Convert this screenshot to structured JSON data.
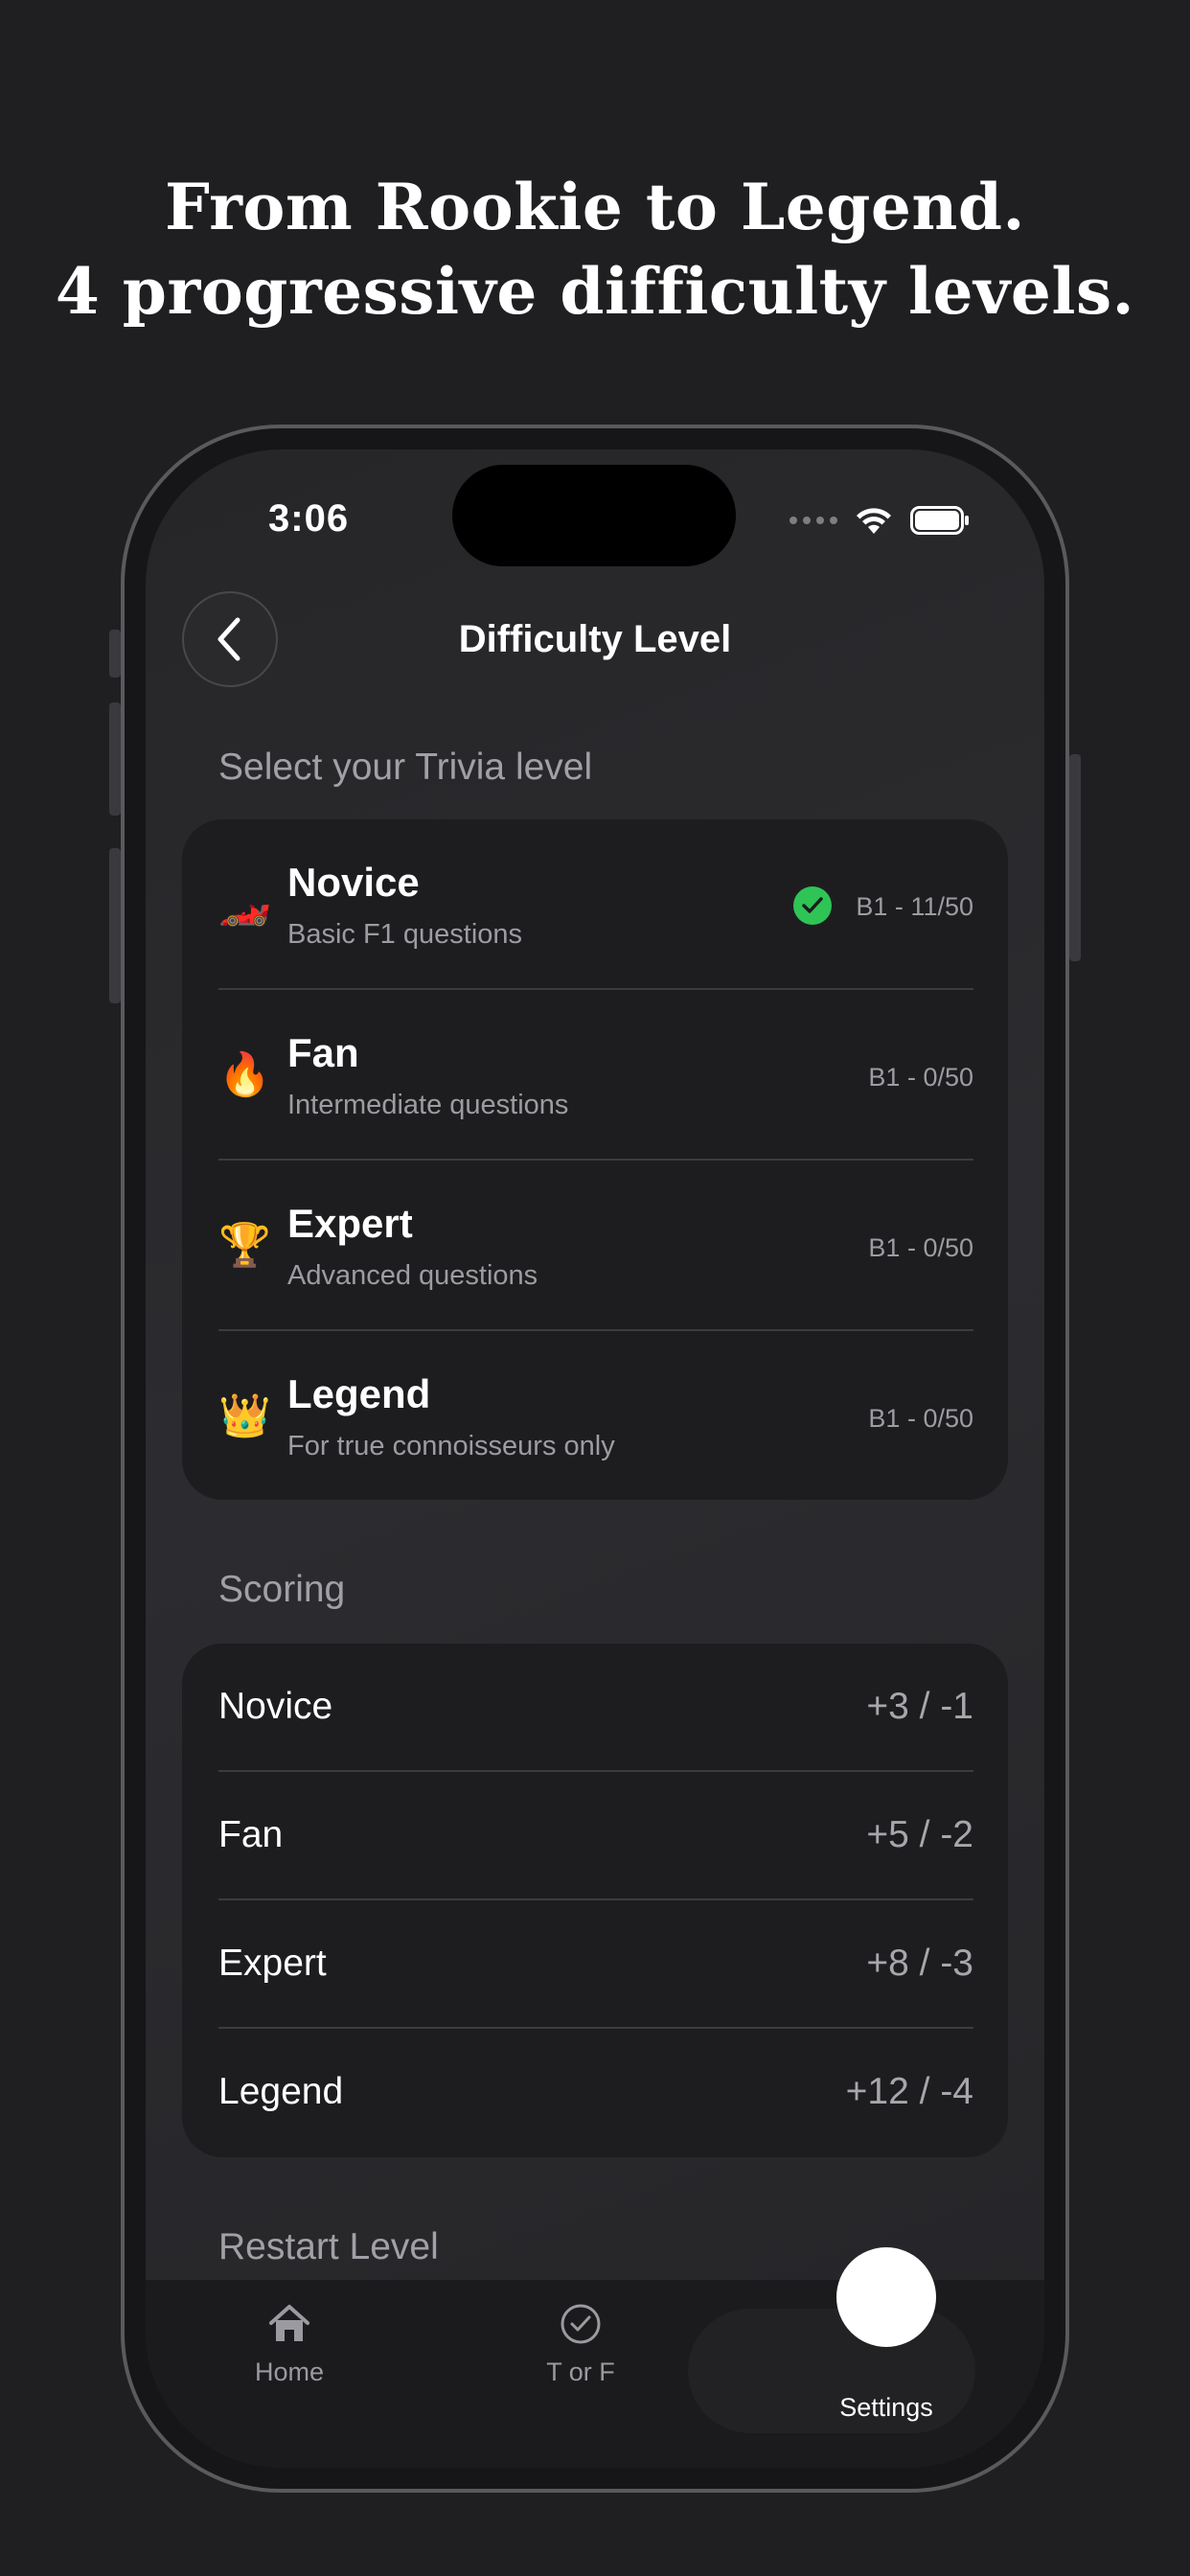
{
  "headline": {
    "line1": "From Rookie to Legend.",
    "line2": "4 progressive difficulty levels."
  },
  "status_bar": {
    "time": "3:06"
  },
  "nav": {
    "title": "Difficulty Level"
  },
  "levels_section": {
    "label": "Select your Trivia level",
    "items": [
      {
        "emoji": "🏎️",
        "icon": "race-car-icon",
        "name": "Novice",
        "description": "Basic F1 questions",
        "progress": "B1 - 11/50",
        "selected": true
      },
      {
        "emoji": "🔥",
        "icon": "fire-icon",
        "name": "Fan",
        "description": "Intermediate questions",
        "progress": "B1 - 0/50",
        "selected": false
      },
      {
        "emoji": "🏆",
        "icon": "trophy-icon",
        "name": "Expert",
        "description": "Advanced questions",
        "progress": "B1 - 0/50",
        "selected": false
      },
      {
        "emoji": "👑",
        "icon": "crown-icon",
        "name": "Legend",
        "description": "For true connoisseurs only",
        "progress": "B1 - 0/50",
        "selected": false
      }
    ]
  },
  "scoring_section": {
    "label": "Scoring",
    "rows": [
      {
        "name": "Novice",
        "value": "+3 / -1"
      },
      {
        "name": "Fan",
        "value": "+5 / -2"
      },
      {
        "name": "Expert",
        "value": "+8 / -3"
      },
      {
        "name": "Legend",
        "value": "+12 / -4"
      }
    ]
  },
  "restart_section": {
    "label": "Restart Level"
  },
  "tab_bar": {
    "tabs": [
      {
        "label": "Home",
        "icon": "house-icon"
      },
      {
        "label": "T or F",
        "icon": "checkmark-circle-icon"
      },
      {
        "label": "Settings",
        "icon": "settings-icon",
        "selected": true
      }
    ]
  },
  "colors": {
    "background": "#1f1f21",
    "card": "#1d1d1f",
    "check_green": "#2fc456"
  }
}
